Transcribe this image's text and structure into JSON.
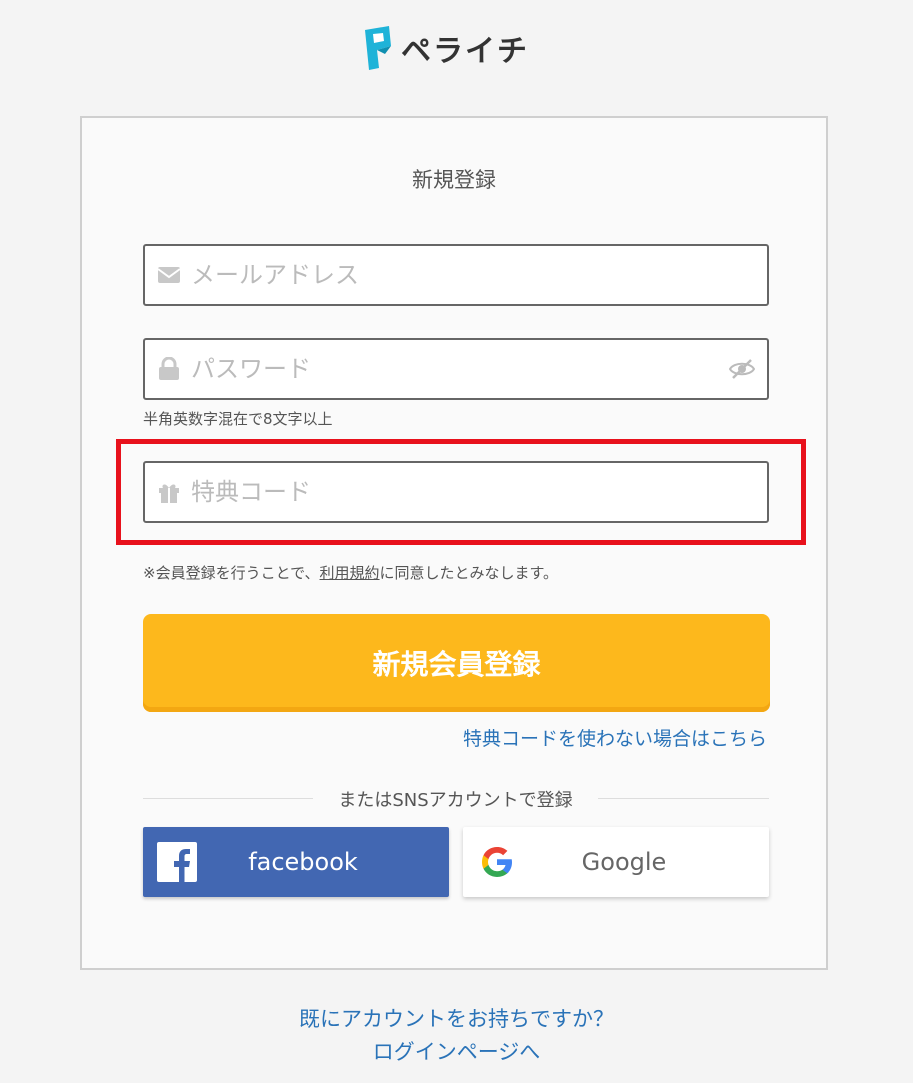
{
  "brand": {
    "name": "ペライチ"
  },
  "form": {
    "title": "新規登録",
    "email": {
      "placeholder": "メールアドレス",
      "value": ""
    },
    "password": {
      "placeholder": "パスワード",
      "value": "",
      "hint": "半角英数字混在で8文字以上"
    },
    "promo": {
      "placeholder": "特典コード",
      "value": ""
    },
    "terms": {
      "prefix": "※会員登録を行うことで、",
      "link": "利用規約",
      "suffix": "に同意したとみなします。"
    },
    "submit_label": "新規会員登録",
    "no_code_link": "特典コードを使わない場合はこちら",
    "sns_divider": "またはSNSアカウントで登録",
    "facebook_label": "facebook",
    "google_label": "Google"
  },
  "footer": {
    "question": "既にアカウントをお持ちですか？",
    "login_link": "ログインページへ"
  },
  "colors": {
    "accent": "#fdb81c",
    "link": "#2a73b8",
    "facebook": "#4267b2",
    "highlight": "#e8111c"
  }
}
